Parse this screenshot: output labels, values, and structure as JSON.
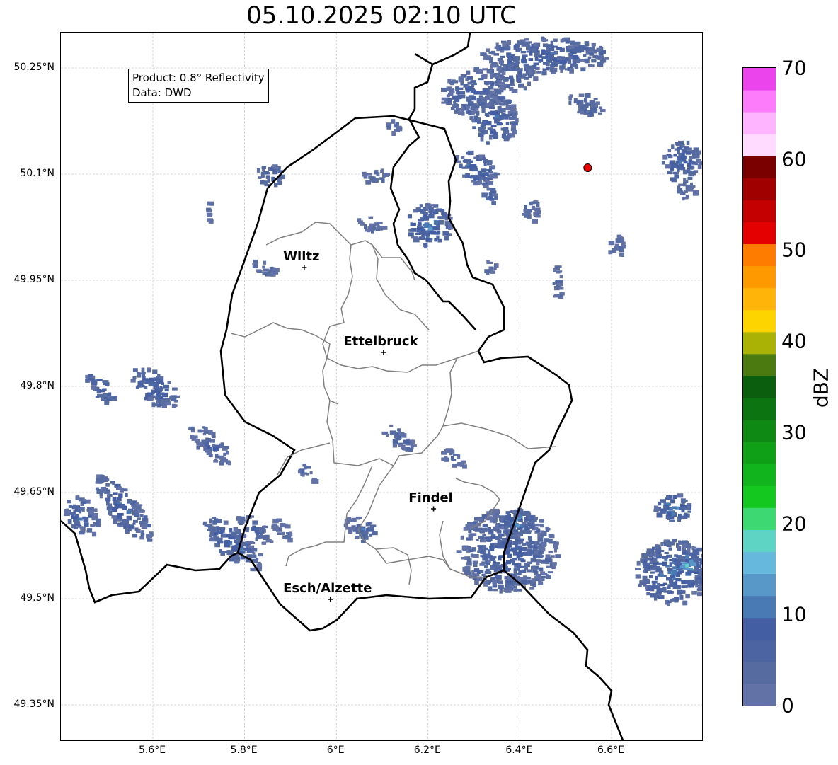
{
  "title": "05.10.2025 02:10 UTC",
  "info": {
    "product": "Product: 0.8° Reflectivity",
    "data": "Data: DWD"
  },
  "lat_ticks": [
    "50.25°N",
    "50.1°N",
    "49.95°N",
    "49.8°N",
    "49.65°N",
    "49.5°N",
    "49.35°N"
  ],
  "lon_ticks": [
    "5.6°E",
    "5.8°E",
    "6°E",
    "6.2°E",
    "6.4°E",
    "6.6°E"
  ],
  "cities": [
    {
      "name": "Wiltz",
      "lon": 5.93,
      "lat": 49.968
    },
    {
      "name": "Ettelbruck",
      "lon": 6.103,
      "lat": 49.848
    },
    {
      "name": "Findel",
      "lon": 6.212,
      "lat": 49.627
    },
    {
      "name": "Esch/Alzette",
      "lon": 5.987,
      "lat": 49.499
    }
  ],
  "radar_site": {
    "lon": 6.548,
    "lat": 50.109,
    "color": "#e60000"
  },
  "colorbar": {
    "label": "dBZ",
    "ticks": [
      "0",
      "10",
      "20",
      "30",
      "40",
      "50",
      "60",
      "70"
    ],
    "range": [
      0,
      70
    ],
    "step": 2.5,
    "colors": [
      "#6272a6",
      "#566ba0",
      "#4c64a2",
      "#445ea4",
      "#4a7ab4",
      "#5898c8",
      "#66b9dc",
      "#5ed4c4",
      "#3ed872",
      "#14c820",
      "#12b41e",
      "#10a018",
      "#0e8a14",
      "#0c7410",
      "#0a5e0e",
      "#4a7a10",
      "#aab206",
      "#fed400",
      "#feb408",
      "#fe9a00",
      "#fe7d00",
      "#e40000",
      "#c40000",
      "#a00000",
      "#7a0000",
      "#ffdcff",
      "#ffb4ff",
      "#fc7cfc",
      "#ec44ec"
    ]
  },
  "echoes": [
    {
      "lon": 6.45,
      "lat": 50.27,
      "a": 0.14,
      "b": 0.025,
      "ang": 0,
      "dbz": 9
    },
    {
      "lon": 6.29,
      "lat": 50.22,
      "a": 0.07,
      "b": 0.03,
      "ang": -20,
      "dbz": 8
    },
    {
      "lon": 6.34,
      "lat": 50.18,
      "a": 0.05,
      "b": 0.035,
      "ang": 0,
      "dbz": 9
    },
    {
      "lon": 6.38,
      "lat": 50.24,
      "a": 0.05,
      "b": 0.02,
      "ang": 0,
      "dbz": 7
    },
    {
      "lon": 6.54,
      "lat": 50.2,
      "a": 0.04,
      "b": 0.015,
      "ang": 20,
      "dbz": 6
    },
    {
      "lon": 6.3,
      "lat": 50.11,
      "a": 0.05,
      "b": 0.02,
      "ang": 30,
      "dbz": 10
    },
    {
      "lon": 6.2,
      "lat": 50.03,
      "a": 0.05,
      "b": 0.03,
      "ang": 30,
      "dbz": 12
    },
    {
      "lon": 6.33,
      "lat": 50.07,
      "a": 0.015,
      "b": 0.012,
      "ang": 0,
      "dbz": 10
    },
    {
      "lon": 6.75,
      "lat": 50.12,
      "a": 0.04,
      "b": 0.03,
      "ang": 20,
      "dbz": 10
    },
    {
      "lon": 6.76,
      "lat": 50.08,
      "a": 0.02,
      "b": 0.015,
      "ang": 0,
      "dbz": 4
    },
    {
      "lon": 6.42,
      "lat": 50.05,
      "a": 0.02,
      "b": 0.015,
      "ang": 0,
      "dbz": 5
    },
    {
      "lon": 6.33,
      "lat": 49.97,
      "a": 0.015,
      "b": 0.01,
      "ang": 40,
      "dbz": 4
    },
    {
      "lon": 6.48,
      "lat": 49.95,
      "a": 0.01,
      "b": 0.03,
      "ang": 0,
      "dbz": 3
    },
    {
      "lon": 6.61,
      "lat": 50.0,
      "a": 0.02,
      "b": 0.015,
      "ang": 30,
      "dbz": 4
    },
    {
      "lon": 5.85,
      "lat": 50.1,
      "a": 0.03,
      "b": 0.015,
      "ang": 0,
      "dbz": 7
    },
    {
      "lon": 6.08,
      "lat": 50.1,
      "a": 0.03,
      "b": 0.01,
      "ang": 0,
      "dbz": 4
    },
    {
      "lon": 6.07,
      "lat": 50.03,
      "a": 0.03,
      "b": 0.01,
      "ang": 20,
      "dbz": 4
    },
    {
      "lon": 6.12,
      "lat": 50.17,
      "a": 0.015,
      "b": 0.01,
      "ang": 0,
      "dbz": 5
    },
    {
      "lon": 5.72,
      "lat": 50.05,
      "a": 0.008,
      "b": 0.015,
      "ang": 0,
      "dbz": 3
    },
    {
      "lon": 5.84,
      "lat": 49.97,
      "a": 0.03,
      "b": 0.01,
      "ang": 30,
      "dbz": 5
    },
    {
      "lon": 5.48,
      "lat": 49.8,
      "a": 0.04,
      "b": 0.012,
      "ang": 50,
      "dbz": 10
    },
    {
      "lon": 5.6,
      "lat": 49.8,
      "a": 0.06,
      "b": 0.02,
      "ang": 40,
      "dbz": 9
    },
    {
      "lon": 5.72,
      "lat": 49.72,
      "a": 0.06,
      "b": 0.015,
      "ang": 45,
      "dbz": 6
    },
    {
      "lon": 5.44,
      "lat": 49.62,
      "a": 0.05,
      "b": 0.02,
      "ang": 50,
      "dbz": 9
    },
    {
      "lon": 5.53,
      "lat": 49.63,
      "a": 0.09,
      "b": 0.02,
      "ang": 50,
      "dbz": 9
    },
    {
      "lon": 5.77,
      "lat": 49.58,
      "a": 0.08,
      "b": 0.02,
      "ang": 40,
      "dbz": 10
    },
    {
      "lon": 5.82,
      "lat": 49.6,
      "a": 0.05,
      "b": 0.012,
      "ang": 40,
      "dbz": 6
    },
    {
      "lon": 5.93,
      "lat": 49.68,
      "a": 0.03,
      "b": 0.008,
      "ang": 55,
      "dbz": 4
    },
    {
      "lon": 5.88,
      "lat": 49.6,
      "a": 0.03,
      "b": 0.01,
      "ang": 40,
      "dbz": 4
    },
    {
      "lon": 6.13,
      "lat": 49.73,
      "a": 0.04,
      "b": 0.012,
      "ang": 35,
      "dbz": 6
    },
    {
      "lon": 6.25,
      "lat": 49.7,
      "a": 0.03,
      "b": 0.01,
      "ang": 30,
      "dbz": 5
    },
    {
      "lon": 6.05,
      "lat": 49.6,
      "a": 0.04,
      "b": 0.015,
      "ang": 30,
      "dbz": 8
    },
    {
      "lon": 6.37,
      "lat": 49.57,
      "a": 0.11,
      "b": 0.06,
      "ang": 5,
      "dbz": 8
    },
    {
      "lon": 6.39,
      "lat": 49.61,
      "a": 0.04,
      "b": 0.02,
      "ang": 0,
      "dbz": 12
    },
    {
      "lon": 6.73,
      "lat": 49.63,
      "a": 0.04,
      "b": 0.02,
      "ang": -10,
      "dbz": 13
    },
    {
      "lon": 6.73,
      "lat": 49.54,
      "a": 0.08,
      "b": 0.045,
      "ang": 0,
      "dbz": 11
    },
    {
      "lon": 6.76,
      "lat": 49.55,
      "a": 0.025,
      "b": 0.015,
      "ang": 0,
      "dbz": 20
    }
  ]
}
